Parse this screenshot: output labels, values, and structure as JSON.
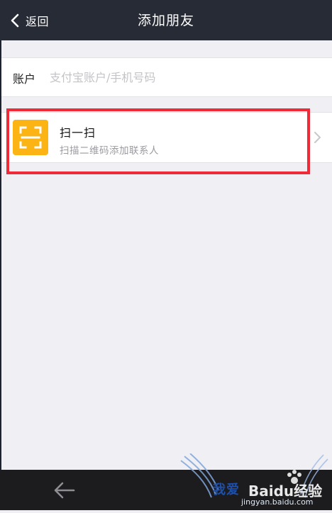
{
  "header": {
    "back_label": "返回",
    "title": "添加朋友"
  },
  "account": {
    "label": "账户",
    "placeholder": "支付宝账户/手机号码",
    "value": ""
  },
  "scan": {
    "title": "扫一扫",
    "subtitle": "扫描二维码添加联系人"
  },
  "colors": {
    "header_bg": "#262b36",
    "page_bg": "#efeff4",
    "scan_icon_bg": "#fbb413",
    "highlight_border": "#ee2b36",
    "bottom_bar_bg": "#1c1c1e"
  },
  "icons": {
    "back": "chevron-left-icon",
    "scan": "scan-frame-icon",
    "row_arrow": "chevron-right-icon",
    "nav_back": "arrow-left-icon"
  },
  "watermark": {
    "brand_cn": "我爱",
    "brand_logo": "Baidu经验",
    "url": "jingyan.baidu.com"
  }
}
